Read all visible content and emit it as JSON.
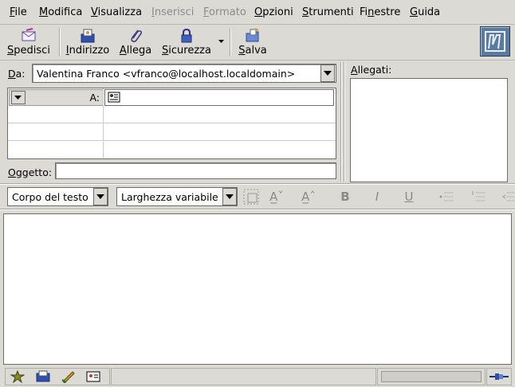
{
  "menu": {
    "items": [
      {
        "label": "File",
        "enabled": true
      },
      {
        "label": "Modifica",
        "enabled": true
      },
      {
        "label": "Visualizza",
        "enabled": true
      },
      {
        "label": "Inserisci",
        "enabled": false
      },
      {
        "label": "Formato",
        "enabled": false
      },
      {
        "label": "Opzioni",
        "enabled": true
      },
      {
        "label": "Strumenti",
        "enabled": true
      },
      {
        "label": "Finestre",
        "enabled": true
      },
      {
        "label": "Guida",
        "enabled": true
      }
    ]
  },
  "toolbar": {
    "send": "Spedisci",
    "address": "Indirizzo",
    "attach": "Allega",
    "security": "Sicurezza",
    "save": "Salva"
  },
  "header": {
    "from_label": "Da:",
    "from_value": "Valentina Franco <vfranco@localhost.localdomain>",
    "to_label": "A:",
    "to_value": "",
    "subject_label": "Oggetto:",
    "subject_value": "",
    "attachments_label": "Allegati:"
  },
  "format": {
    "paragraph_style": "Corpo del testo",
    "font": "Larghezza variabile"
  },
  "colors": {
    "background": "#dcdad5",
    "grid": "#c9c7e6"
  }
}
